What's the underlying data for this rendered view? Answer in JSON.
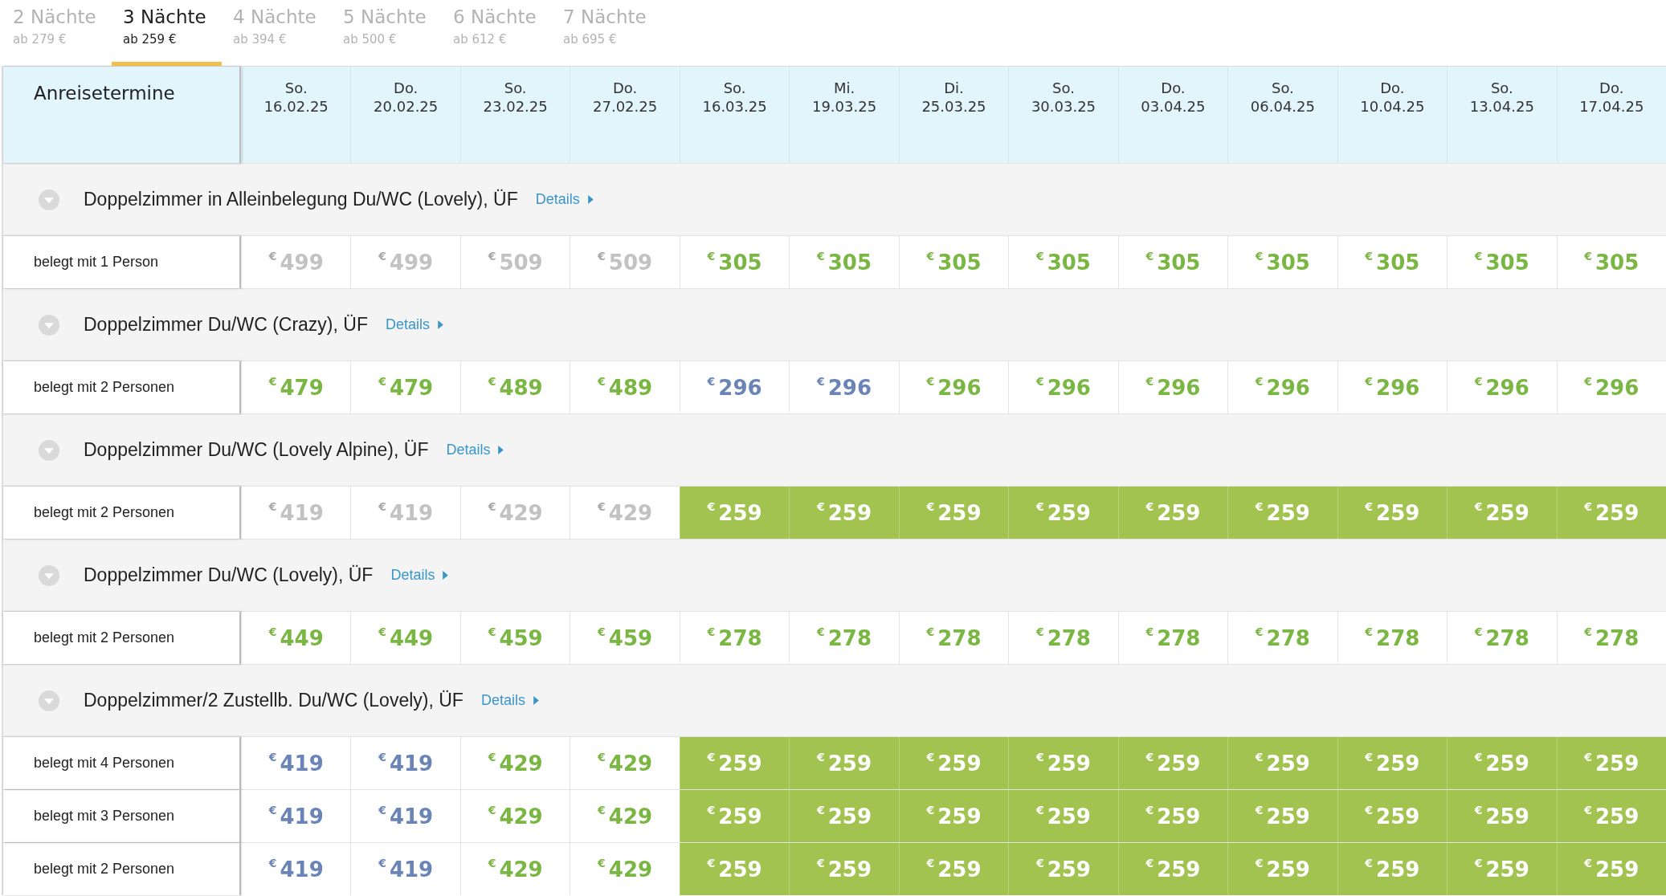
{
  "tabs": [
    {
      "label": "2 Nächte",
      "price": "ab 279 €",
      "selected": false
    },
    {
      "label": "3 Nächte",
      "price": "ab 259 €",
      "selected": true
    },
    {
      "label": "4 Nächte",
      "price": "ab 394 €",
      "selected": false
    },
    {
      "label": "5 Nächte",
      "price": "ab 500 €",
      "selected": false
    },
    {
      "label": "6 Nächte",
      "price": "ab 612 €",
      "selected": false
    },
    {
      "label": "7 Nächte",
      "price": "ab 695 €",
      "selected": false
    }
  ],
  "table": {
    "corner": "Anreisetermine",
    "columns": [
      {
        "day": "So.",
        "date": "16.02.25"
      },
      {
        "day": "Do.",
        "date": "20.02.25"
      },
      {
        "day": "So.",
        "date": "23.02.25"
      },
      {
        "day": "Do.",
        "date": "27.02.25"
      },
      {
        "day": "So.",
        "date": "16.03.25"
      },
      {
        "day": "Mi.",
        "date": "19.03.25"
      },
      {
        "day": "Di.",
        "date": "25.03.25"
      },
      {
        "day": "So.",
        "date": "30.03.25"
      },
      {
        "day": "Do.",
        "date": "03.04.25"
      },
      {
        "day": "So.",
        "date": "06.04.25"
      },
      {
        "day": "Do.",
        "date": "10.04.25"
      },
      {
        "day": "So.",
        "date": "13.04.25"
      },
      {
        "day": "Do.",
        "date": "17.04.25"
      }
    ],
    "groups": [
      {
        "title": "Doppelzimmer in Alleinbelegung Du/WC (Lovely), ÜF",
        "link": "Details",
        "rows": [
          {
            "label": "belegt mit 1 Person",
            "cells": [
              {
                "price": "499",
                "kind": "unavailable"
              },
              {
                "price": "499",
                "kind": "unavailable"
              },
              {
                "price": "509",
                "kind": "unavailable"
              },
              {
                "price": "509",
                "kind": "unavailable"
              },
              {
                "price": "305",
                "kind": "available"
              },
              {
                "price": "305",
                "kind": "available"
              },
              {
                "price": "305",
                "kind": "available"
              },
              {
                "price": "305",
                "kind": "available"
              },
              {
                "price": "305",
                "kind": "available"
              },
              {
                "price": "305",
                "kind": "available"
              },
              {
                "price": "305",
                "kind": "available"
              },
              {
                "price": "305",
                "kind": "available"
              },
              {
                "price": "305",
                "kind": "available"
              }
            ]
          }
        ]
      },
      {
        "title": "Doppelzimmer Du/WC (Crazy), ÜF",
        "link": "Details",
        "rows": [
          {
            "label": "belegt mit 2 Personen",
            "cells": [
              {
                "price": "479",
                "kind": "available"
              },
              {
                "price": "479",
                "kind": "available"
              },
              {
                "price": "489",
                "kind": "available"
              },
              {
                "price": "489",
                "kind": "available"
              },
              {
                "price": "296",
                "kind": "request"
              },
              {
                "price": "296",
                "kind": "request"
              },
              {
                "price": "296",
                "kind": "available"
              },
              {
                "price": "296",
                "kind": "available"
              },
              {
                "price": "296",
                "kind": "available"
              },
              {
                "price": "296",
                "kind": "available"
              },
              {
                "price": "296",
                "kind": "available"
              },
              {
                "price": "296",
                "kind": "available"
              },
              {
                "price": "296",
                "kind": "available"
              }
            ]
          }
        ]
      },
      {
        "title": "Doppelzimmer Du/WC (Lovely Alpine), ÜF",
        "link": "Details",
        "rows": [
          {
            "label": "belegt mit 2 Personen",
            "cells": [
              {
                "price": "419",
                "kind": "unavailable"
              },
              {
                "price": "419",
                "kind": "unavailable"
              },
              {
                "price": "429",
                "kind": "unavailable"
              },
              {
                "price": "429",
                "kind": "unavailable"
              },
              {
                "price": "259",
                "kind": "best"
              },
              {
                "price": "259",
                "kind": "best"
              },
              {
                "price": "259",
                "kind": "best"
              },
              {
                "price": "259",
                "kind": "best"
              },
              {
                "price": "259",
                "kind": "best"
              },
              {
                "price": "259",
                "kind": "best"
              },
              {
                "price": "259",
                "kind": "best"
              },
              {
                "price": "259",
                "kind": "best"
              },
              {
                "price": "259",
                "kind": "best"
              }
            ]
          }
        ]
      },
      {
        "title": "Doppelzimmer Du/WC (Lovely), ÜF",
        "link": "Details",
        "rows": [
          {
            "label": "belegt mit 2 Personen",
            "cells": [
              {
                "price": "449",
                "kind": "available"
              },
              {
                "price": "449",
                "kind": "available"
              },
              {
                "price": "459",
                "kind": "available"
              },
              {
                "price": "459",
                "kind": "available"
              },
              {
                "price": "278",
                "kind": "available"
              },
              {
                "price": "278",
                "kind": "available"
              },
              {
                "price": "278",
                "kind": "available"
              },
              {
                "price": "278",
                "kind": "available"
              },
              {
                "price": "278",
                "kind": "available"
              },
              {
                "price": "278",
                "kind": "available"
              },
              {
                "price": "278",
                "kind": "available"
              },
              {
                "price": "278",
                "kind": "available"
              },
              {
                "price": "278",
                "kind": "available"
              }
            ]
          }
        ]
      },
      {
        "title": "Doppelzimmer/2 Zustellb. Du/WC (Lovely), ÜF",
        "link": "Details",
        "rows": [
          {
            "label": "belegt mit 4 Personen",
            "cells": [
              {
                "price": "419",
                "kind": "request"
              },
              {
                "price": "419",
                "kind": "request"
              },
              {
                "price": "429",
                "kind": "available"
              },
              {
                "price": "429",
                "kind": "available"
              },
              {
                "price": "259",
                "kind": "best"
              },
              {
                "price": "259",
                "kind": "best"
              },
              {
                "price": "259",
                "kind": "best"
              },
              {
                "price": "259",
                "kind": "best"
              },
              {
                "price": "259",
                "kind": "best"
              },
              {
                "price": "259",
                "kind": "best"
              },
              {
                "price": "259",
                "kind": "best"
              },
              {
                "price": "259",
                "kind": "best"
              },
              {
                "price": "259",
                "kind": "best"
              }
            ]
          },
          {
            "label": "belegt mit 3 Personen",
            "cells": [
              {
                "price": "419",
                "kind": "request"
              },
              {
                "price": "419",
                "kind": "request"
              },
              {
                "price": "429",
                "kind": "available"
              },
              {
                "price": "429",
                "kind": "available"
              },
              {
                "price": "259",
                "kind": "best"
              },
              {
                "price": "259",
                "kind": "best"
              },
              {
                "price": "259",
                "kind": "best"
              },
              {
                "price": "259",
                "kind": "best"
              },
              {
                "price": "259",
                "kind": "best"
              },
              {
                "price": "259",
                "kind": "best"
              },
              {
                "price": "259",
                "kind": "best"
              },
              {
                "price": "259",
                "kind": "best"
              },
              {
                "price": "259",
                "kind": "best"
              }
            ]
          },
          {
            "label": "belegt mit 2 Personen",
            "cells": [
              {
                "price": "419",
                "kind": "request"
              },
              {
                "price": "419",
                "kind": "request"
              },
              {
                "price": "429",
                "kind": "available"
              },
              {
                "price": "429",
                "kind": "available"
              },
              {
                "price": "259",
                "kind": "best"
              },
              {
                "price": "259",
                "kind": "best"
              },
              {
                "price": "259",
                "kind": "best"
              },
              {
                "price": "259",
                "kind": "best"
              },
              {
                "price": "259",
                "kind": "best"
              },
              {
                "price": "259",
                "kind": "best"
              },
              {
                "price": "259",
                "kind": "best"
              },
              {
                "price": "259",
                "kind": "best"
              },
              {
                "price": "259",
                "kind": "best"
              }
            ]
          }
        ]
      }
    ],
    "currency": "€"
  }
}
